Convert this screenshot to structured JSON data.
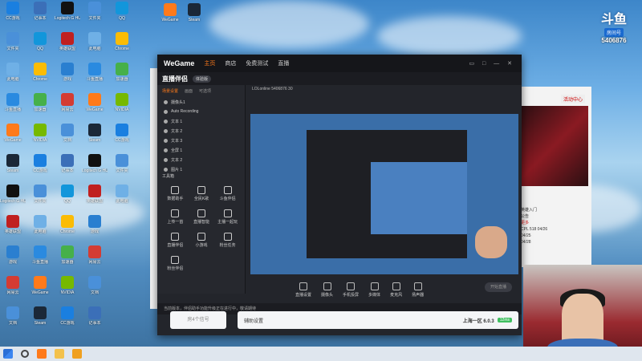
{
  "huya": {
    "logo": "斗鱼",
    "tag": "房间号",
    "room_number": "5406876"
  },
  "desktop_icons": [
    {
      "label": "CC游戏",
      "color": "#1a7fe0"
    },
    {
      "label": "文件夹",
      "color": "#4a90d9"
    },
    {
      "label": "此电脑",
      "color": "#6fb0e6"
    },
    {
      "label": "斗鱼直播",
      "color": "#2a8ae0"
    },
    {
      "label": "WeGame",
      "color": "#ff7a1a"
    },
    {
      "label": "Steam",
      "color": "#1b2838"
    },
    {
      "label": "Logitech G HUB",
      "color": "#111111"
    },
    {
      "label": "英雄联盟",
      "color": "#c02020"
    },
    {
      "label": "游戏",
      "color": "#2a7fd0"
    },
    {
      "label": "网易云",
      "color": "#d43c33"
    },
    {
      "label": "文档",
      "color": "#4a90d9"
    },
    {
      "label": "记事本",
      "color": "#3b6fb8"
    },
    {
      "label": "QQ",
      "color": "#1296db"
    },
    {
      "label": "Chrome",
      "color": "#fbbc05"
    },
    {
      "label": "加速器",
      "color": "#46b04a"
    },
    {
      "label": "NVIDIA",
      "color": "#76b900"
    }
  ],
  "wegame": {
    "brand": "WeGame",
    "nav": [
      "主页",
      "商店",
      "免费测试",
      "直播"
    ],
    "controls": "▭ □ — ✕"
  },
  "zhibo": {
    "title": "直播伴侣",
    "pill": "体验版",
    "tabs": [
      "场景设置",
      "画面",
      "可选项"
    ],
    "sources": [
      "摄像头1",
      "Auto Recording",
      "文本 1",
      "文本 2",
      "文本 3",
      "全屏 1",
      "文本 2",
      "图片 1"
    ],
    "tools_title": "工具箱",
    "tools": [
      "数据助手",
      "全民K歌",
      "斗鱼伴侣",
      "上传一首",
      "直播智能",
      "主播一起玩",
      "直播伴侣",
      "小游戏",
      "粉丝任务",
      "粉丝伴侣"
    ],
    "info": [
      "LOLonline",
      "5406876",
      "30"
    ],
    "bottom_items": [
      "直播设置",
      "摄像头",
      "手机投屏",
      "多媒体",
      "麦克风",
      "扬声器"
    ],
    "start_label": "开始直播",
    "footer_text": "当前版本，伴侣助手功能升级正在进行中，敬请期待",
    "server_label": "辅助设置",
    "server_value": "上海一区 6.0.3",
    "ping": "12ms",
    "room_label": "房4个信号"
  },
  "right_panel": {
    "activity": "活动中心",
    "enter": "英雄入门",
    "notice": [
      "公告",
      "更多",
      "CPL 518 04/26",
      "04/25",
      "04/28"
    ]
  },
  "taskbar": {
    "items": [
      "start",
      "search",
      "wegame",
      "folder",
      "huya"
    ]
  }
}
